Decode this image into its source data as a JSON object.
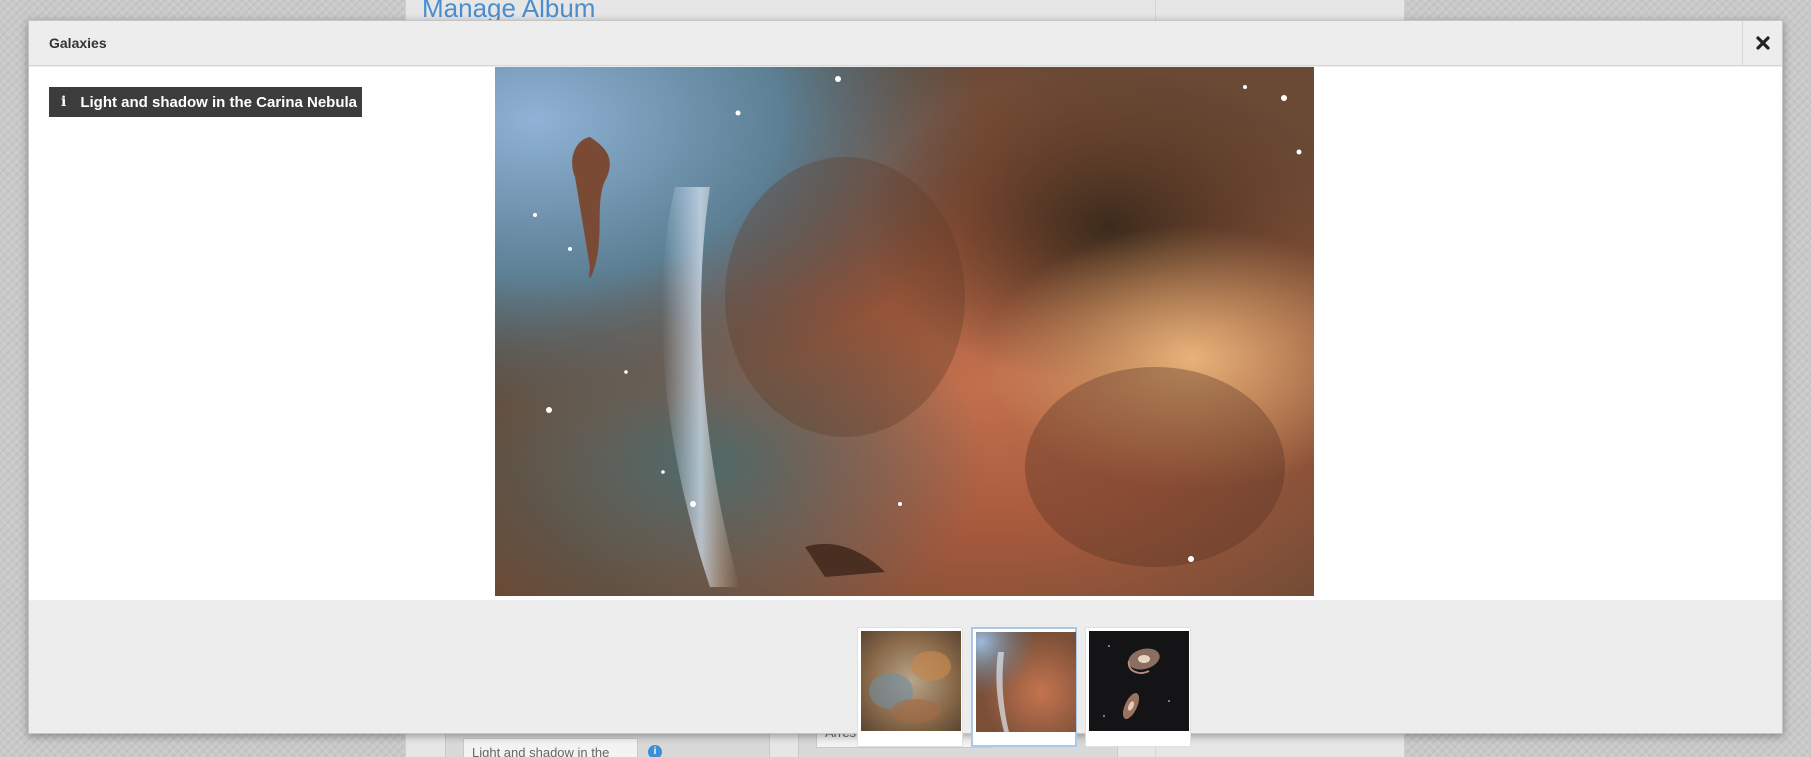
{
  "background": {
    "heading": "Manage Album",
    "left_field_value": "Light and shadow in the",
    "right_field_value": "Arrest made of galaxies"
  },
  "modal": {
    "title": "Galaxies",
    "close_icon": "close-icon",
    "caption": {
      "icon": "info-icon",
      "text": "Light and shadow in the Carina Nebula"
    },
    "thumbnails": [
      {
        "name": "thumbnail-nebula-mosaic",
        "active": false
      },
      {
        "name": "thumbnail-carina-nebula",
        "active": true
      },
      {
        "name": "thumbnail-interacting-galaxies",
        "active": false
      }
    ]
  },
  "colors": {
    "caption_bg": "#3c3c3c",
    "accent": "#4a8ed0",
    "modal_bg": "#ededed",
    "active_thumb_border": "#a9c8ea"
  }
}
